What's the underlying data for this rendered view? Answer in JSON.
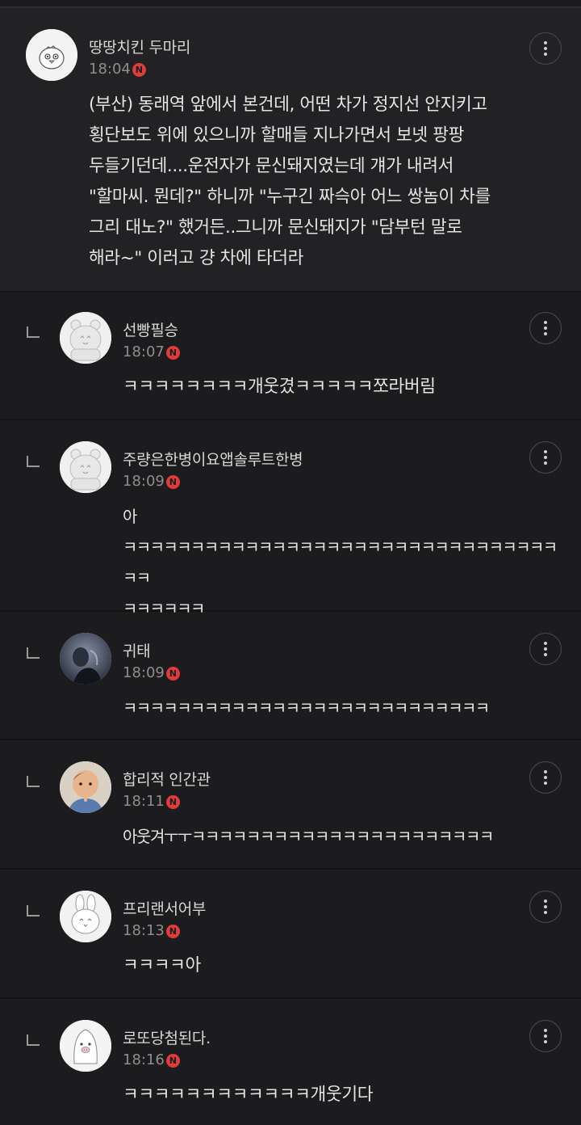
{
  "comments": [
    {
      "nickname": "땅땅치킨 두마리",
      "time": "18:04",
      "badge": "N",
      "text": "(부산) 동래역 앞에서 본건데, 어떤 차가 정지선 안지키고\n횡단보도 위에 있으니까 할매들 지나가면서 보넷 팡팡\n두들기던데....운전자가 문신돼지였는데 걔가 내려서\n\"할마씨. 뭔데?\" 하니까 \"누구긴 짜슥아 어느 쌍놈이 차를\n그리 대노?\" 했거든..그니까 문신돼지가 \"담부턴 말로\n해라~\" 이러고 걍 차에 타더라",
      "avatar_icon": "chick-avatar-icon",
      "more_icon": "more-vertical-icon"
    },
    {
      "nickname": "선빵필승",
      "time": "18:07",
      "badge": "N",
      "text": "ㅋㅋㅋㅋㅋㅋㅋㅋ개웃겼ㅋㅋㅋㅋㅋ쪼라버림",
      "avatar_icon": "bear-avatar-icon",
      "more_icon": "more-vertical-icon"
    },
    {
      "nickname": "주량은한병이요앱솔루트한병",
      "time": "18:09",
      "badge": "N",
      "text": "아\nㅋㅋㅋㅋㅋㅋㅋㅋㅋㅋㅋㅋㅋㅋㅋㅋㅋㅋㅋㅋㅋㅋㅋㅋㅋㅋㅋㅋㅋㅋㅋㅋㅋㅋ\nㅋㅋㅋㅋㅋㅋ",
      "avatar_icon": "bear-avatar-icon",
      "more_icon": "more-vertical-icon"
    },
    {
      "nickname": "귀태",
      "time": "18:09",
      "badge": "N",
      "text": "ㅋㅋㅋㅋㅋㅋㅋㅋㅋㅋㅋㅋㅋㅋㅋㅋㅋㅋㅋㅋㅋㅋㅋㅋㅋㅋㅋ",
      "avatar_icon": "photo-avatar-icon",
      "more_icon": "more-vertical-icon"
    },
    {
      "nickname": "합리적 인간관",
      "time": "18:11",
      "badge": "N",
      "text": "아웃겨ㅜㅜㅋㅋㅋㅋㅋㅋㅋㅋㅋㅋㅋㅋㅋㅋㅋㅋㅋㅋㅋㅋㅋㅋ",
      "avatar_icon": "child-photo-avatar-icon",
      "more_icon": "more-vertical-icon"
    },
    {
      "nickname": "프리랜서어부",
      "time": "18:13",
      "badge": "N",
      "text": "ㅋㅋㅋㅋ아",
      "avatar_icon": "rabbit-avatar-icon",
      "more_icon": "more-vertical-icon"
    },
    {
      "nickname": "로또당첨된다.",
      "time": "18:16",
      "badge": "N",
      "text": "ㅋㅋㅋㅋㅋㅋㅋㅋㅋㅋㅋㅋ개웃기다",
      "avatar_icon": "pig-avatar-icon",
      "more_icon": "more-vertical-icon"
    }
  ]
}
